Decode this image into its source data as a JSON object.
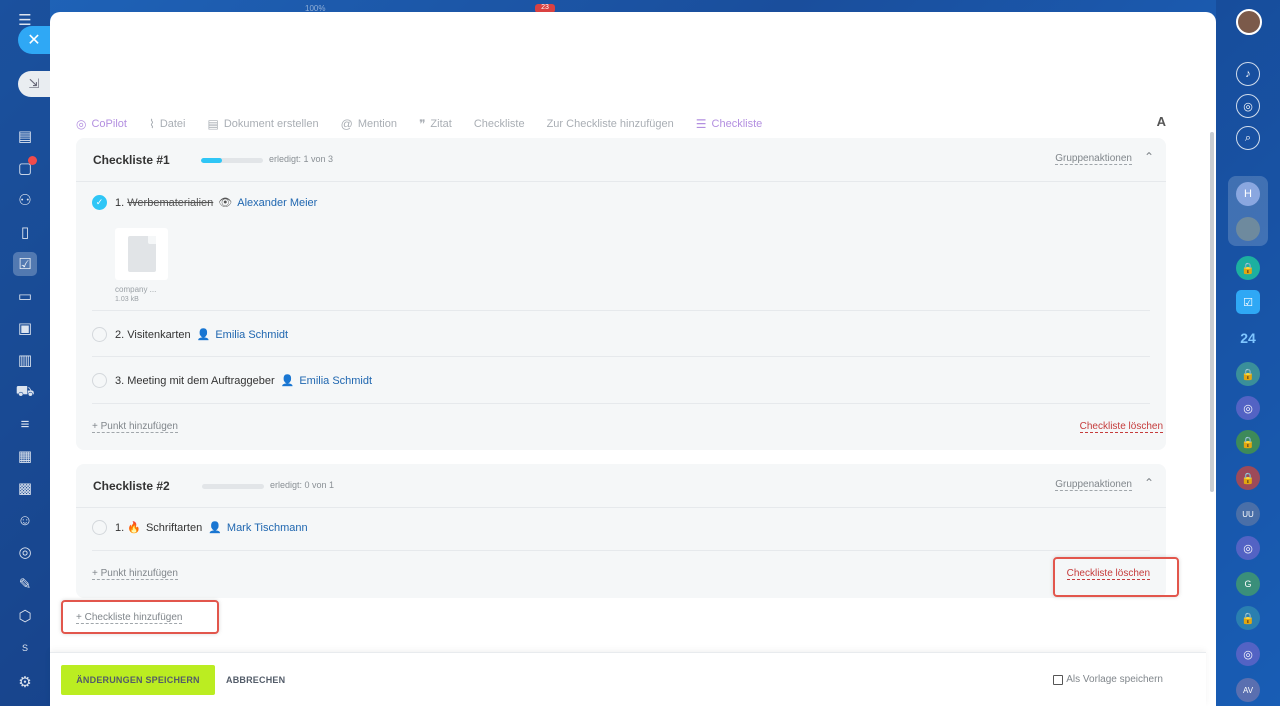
{
  "toolbar": {
    "items": [
      "CoPilot",
      "Datei",
      "Dokument erstellen",
      "Mention",
      "Zitat",
      "Checkliste",
      "Zur Checkliste hinzufügen",
      "Checkliste"
    ],
    "font_label": "A"
  },
  "checklists": [
    {
      "title": "Checkliste #1",
      "progress": 0.333,
      "done_text": "erledigt: 1 von 3",
      "group_actions": "Gruppenaktionen",
      "items": [
        {
          "label": "1.",
          "text": "Werbematerialien",
          "person": "Alexander Meier",
          "done": true
        },
        {
          "label": "2.",
          "text": "Visitenkarten",
          "person": "Emilia Schmidt",
          "done": false
        },
        {
          "label": "3.",
          "text": "Meeting mit dem Auftraggeber",
          "person": "Emilia Schmidt",
          "done": false
        }
      ],
      "file": {
        "name": "company ...",
        "size": "1.03 kB"
      },
      "add_point": "+ Punkt hinzufügen",
      "delete": "Checkliste löschen"
    },
    {
      "title": "Checkliste #2",
      "progress": 0,
      "done_text": "erledigt: 0 von 1",
      "group_actions": "Gruppenaktionen",
      "items": [
        {
          "label": "1.",
          "text": "Schriftarten",
          "person": "Mark Tischmann",
          "done": false
        }
      ],
      "add_point": "+ Punkt hinzufügen",
      "delete": "Checkliste löschen"
    }
  ],
  "add_checklist": "+ Checkliste hinzufügen",
  "footer": {
    "save": "ÄNDERUNGEN SPEICHERN",
    "cancel": "ABBRECHEN",
    "template": "Als Vorlage speichern"
  },
  "right_rail": {
    "counter": "24",
    "letters": [
      "H",
      "UU",
      "G",
      "AV"
    ]
  },
  "left_rail": {
    "letter": "S"
  },
  "top_bar": {
    "zoom": "100%",
    "badge": "23"
  },
  "colors": {
    "accent": "#2fc6f6",
    "save": "#bbed21",
    "link": "#2067b0",
    "danger": "#c53c3c",
    "highlight": "#e2564c"
  }
}
